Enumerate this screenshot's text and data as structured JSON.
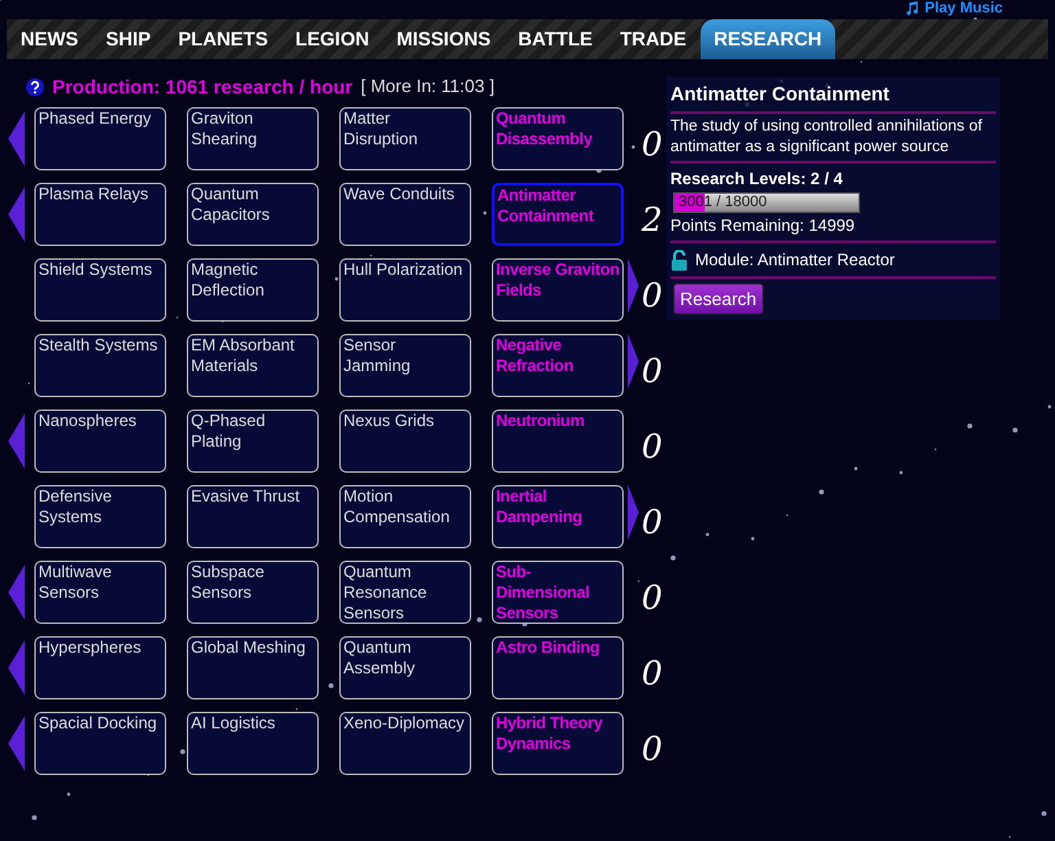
{
  "header": {
    "music_link": "Play Music"
  },
  "tabs": [
    {
      "label": "NEWS",
      "selected": false
    },
    {
      "label": "SHIP",
      "selected": false
    },
    {
      "label": "PLANETS",
      "selected": false
    },
    {
      "label": "LEGION",
      "selected": false
    },
    {
      "label": "MISSIONS",
      "selected": false
    },
    {
      "label": "BATTLE",
      "selected": false
    },
    {
      "label": "TRADE",
      "selected": false
    },
    {
      "label": "RESEARCH",
      "selected": true
    }
  ],
  "production": {
    "label": "Production: 1061 research / hour",
    "timer": "[ More In: 11:03 ]"
  },
  "rows": [
    {
      "arrow_left": true,
      "arrow_right": false,
      "items": [
        {
          "name": "Phased Energy",
          "selected": false
        },
        {
          "name": "Graviton Shearing",
          "selected": false
        },
        {
          "name": "Matter Disruption",
          "selected": false
        },
        {
          "name": "Quantum Disassembly",
          "selected": false
        }
      ],
      "count": "0"
    },
    {
      "arrow_left": true,
      "arrow_right": false,
      "items": [
        {
          "name": "Plasma Relays",
          "selected": false
        },
        {
          "name": "Quantum Capacitors",
          "selected": false
        },
        {
          "name": "Wave Conduits",
          "selected": false
        },
        {
          "name": "Antimatter Containment",
          "selected": true
        }
      ],
      "count": "2"
    },
    {
      "arrow_left": false,
      "arrow_right": true,
      "items": [
        {
          "name": "Shield Systems",
          "selected": false
        },
        {
          "name": "Magnetic Deflection",
          "selected": false
        },
        {
          "name": "Hull Polarization",
          "selected": false
        },
        {
          "name": "Inverse Graviton Fields",
          "selected": false
        }
      ],
      "count": "0"
    },
    {
      "arrow_left": false,
      "arrow_right": true,
      "items": [
        {
          "name": "Stealth Systems",
          "selected": false
        },
        {
          "name": "EM Absorbant Materials",
          "selected": false
        },
        {
          "name": "Sensor Jamming",
          "selected": false
        },
        {
          "name": "Negative Refraction",
          "selected": false
        }
      ],
      "count": "0"
    },
    {
      "arrow_left": true,
      "arrow_right": false,
      "items": [
        {
          "name": "Nanospheres",
          "selected": false
        },
        {
          "name": "Q-Phased Plating",
          "selected": false
        },
        {
          "name": "Nexus Grids",
          "selected": false
        },
        {
          "name": "Neutronium",
          "selected": false
        }
      ],
      "count": "0"
    },
    {
      "arrow_left": false,
      "arrow_right": true,
      "items": [
        {
          "name": "Defensive Systems",
          "selected": false
        },
        {
          "name": "Evasive Thrust",
          "selected": false
        },
        {
          "name": "Motion Compensation",
          "selected": false
        },
        {
          "name": "Inertial Dampening",
          "selected": false
        }
      ],
      "count": "0"
    },
    {
      "arrow_left": true,
      "arrow_right": false,
      "items": [
        {
          "name": "Multiwave Sensors",
          "selected": false
        },
        {
          "name": "Subspace Sensors",
          "selected": false
        },
        {
          "name": "Quantum Resonance Sensors",
          "selected": false
        },
        {
          "name": "Sub-Dimensional Sensors",
          "selected": false
        }
      ],
      "count": "0"
    },
    {
      "arrow_left": true,
      "arrow_right": false,
      "items": [
        {
          "name": "Hyperspheres",
          "selected": false
        },
        {
          "name": "Global Meshing",
          "selected": false
        },
        {
          "name": "Quantum Assembly",
          "selected": false
        },
        {
          "name": "Astro Binding",
          "selected": false
        }
      ],
      "count": "0"
    },
    {
      "arrow_left": true,
      "arrow_right": false,
      "items": [
        {
          "name": "Spacial Docking",
          "selected": false
        },
        {
          "name": "AI Logistics",
          "selected": false
        },
        {
          "name": "Xeno-Diplomacy",
          "selected": false
        },
        {
          "name": "Hybrid Theory Dynamics",
          "selected": false
        }
      ],
      "count": "0"
    }
  ],
  "detail": {
    "title": "Antimatter Containment",
    "description": "The study of using controlled annihilations of antimatter as a significant power source",
    "levels": "Research Levels: 2 / 4",
    "progress": {
      "text": "3001 / 18000",
      "level": 0.167
    },
    "remaining": "Points Remaining: 14999",
    "module": "Module: Antimatter Reactor",
    "button": "Research"
  }
}
